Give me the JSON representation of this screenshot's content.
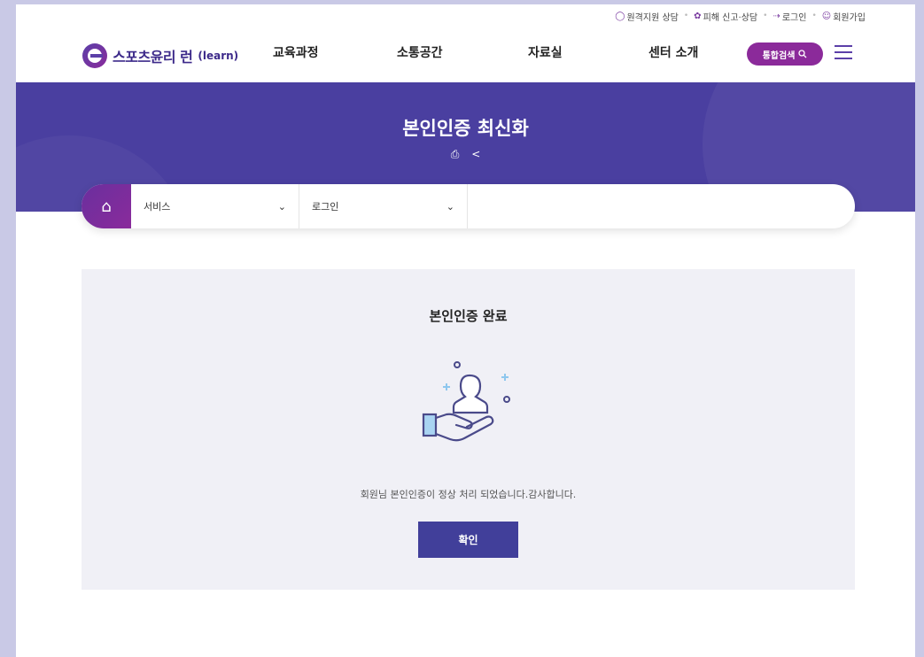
{
  "utility": {
    "remote": "원격지원 상담",
    "report": "피해 신고·상담",
    "login": "로그인",
    "join": "회원가입"
  },
  "logo": {
    "main": "스포츠윤리 런",
    "sub": "(learn)"
  },
  "nav": [
    "교육과정",
    "소통공간",
    "자료실",
    "센터 소개"
  ],
  "search": {
    "label": "통합검색"
  },
  "banner": {
    "title": "본인인증 최신화"
  },
  "breadcrumb": {
    "level1": "서비스",
    "level2": "로그인"
  },
  "panel": {
    "title": "본인인증 완료",
    "message": "회원님 본인인증이 정상 처리 되었습니다.감사합니다.",
    "confirm": "확인"
  },
  "colors": {
    "brand": "#4a3fa0",
    "accent": "#8b2a9a",
    "button": "#413f9a",
    "panel": "#f0f0f6"
  }
}
